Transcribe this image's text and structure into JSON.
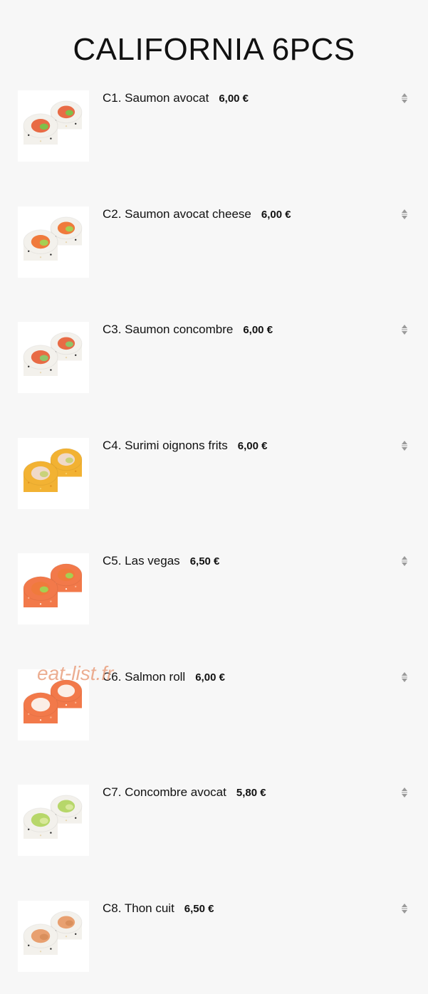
{
  "page": {
    "title": "CALIFORNIA 6PCS"
  },
  "watermark": "eat-list.fr",
  "items": [
    {
      "label": "C1. Saumon avocat",
      "price": "6,00 €",
      "image": "salmon-avocado-roll",
      "rice": "white",
      "filling": [
        "#e86b45",
        "#7fbf4a"
      ]
    },
    {
      "label": "C2. Saumon avocat cheese",
      "price": "6,00 €",
      "image": "salmon-avocado-cheese-roll",
      "rice": "white",
      "filling": [
        "#f07a3c",
        "#a6cf52"
      ]
    },
    {
      "label": "C3. Saumon concombre",
      "price": "6,00 €",
      "image": "salmon-cucumber-roll",
      "rice": "white",
      "filling": [
        "#e86b45",
        "#8fc46a"
      ]
    },
    {
      "label": "C4. Surimi oignons frits",
      "price": "6,00 €",
      "image": "surimi-fried-onion-roll",
      "rice": "gold",
      "filling": [
        "#f0d9c8",
        "#c9d27a"
      ]
    },
    {
      "label": "C5. Las vegas",
      "price": "6,50 €",
      "image": "las-vegas-roll",
      "rice": "salmon",
      "filling": [
        "#f07a3c",
        "#a6cf52"
      ]
    },
    {
      "label": "C6. Salmon roll",
      "price": "6,00 €",
      "image": "salmon-roll",
      "rice": "salmon",
      "filling": [
        "#fbeee6",
        "#fbeee6"
      ]
    },
    {
      "label": "C7. Concombre avocat",
      "price": "5,80 €",
      "image": "cucumber-avocado-roll",
      "rice": "white",
      "filling": [
        "#b7d76a",
        "#d8e89a"
      ]
    },
    {
      "label": "C8. Thon cuit",
      "price": "6,50 €",
      "image": "cooked-tuna-roll",
      "rice": "white",
      "filling": [
        "#e8a070",
        "#d98f5c"
      ]
    }
  ]
}
